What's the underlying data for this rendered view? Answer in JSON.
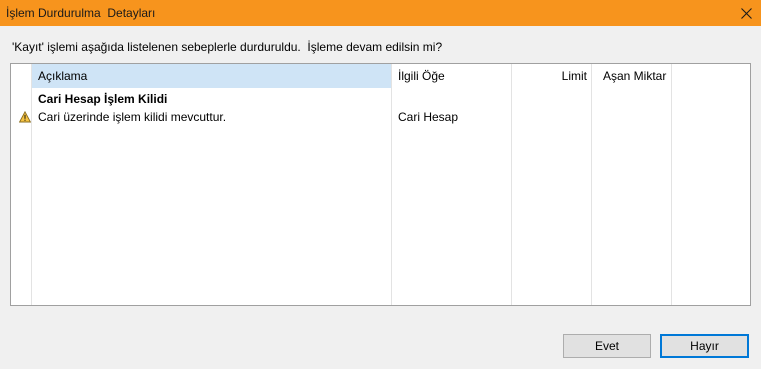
{
  "window": {
    "title": "İşlem Durdurulma  Detayları",
    "close_icon": "close-icon"
  },
  "message": "'Kayıt' işlemi aşağıda listelenen sebeplerle durduruldu.  İşleme devam edilsin mi?",
  "table": {
    "columns": [
      "Açıklama",
      "İlgili Öğe",
      "Limit",
      "Aşan Miktar"
    ],
    "group_title": "Cari Hesap İşlem Kilidi",
    "rows": [
      {
        "icon": "warning-icon",
        "description": "Cari üzerinde işlem kilidi mevcuttur.",
        "related_item": "Cari Hesap",
        "limit": "",
        "exceeding_amount": ""
      }
    ]
  },
  "buttons": {
    "yes": "Evet",
    "no": "Hayır"
  },
  "colors": {
    "titlebar": "#f7941d",
    "header_selected": "#cfe4f6",
    "default_button_border": "#0078d7"
  }
}
